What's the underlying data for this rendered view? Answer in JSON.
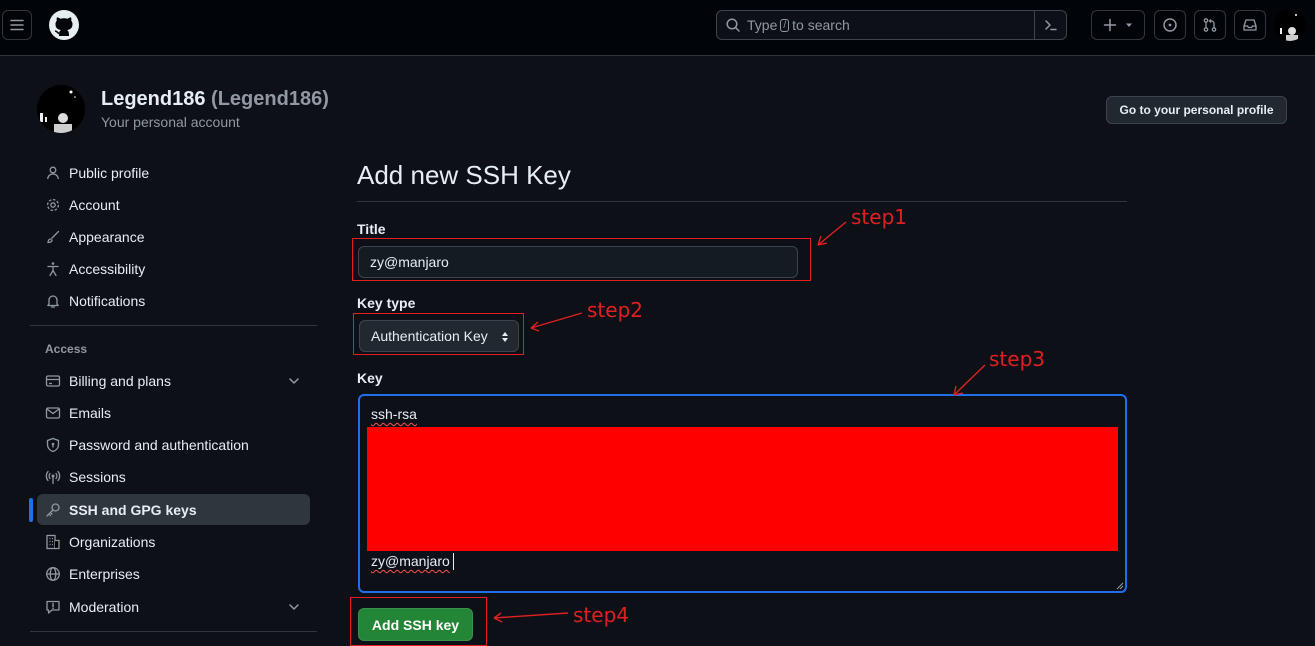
{
  "header": {
    "menu_icon": "hamburger-icon",
    "logo": "github-mark-logo",
    "search_prefix": "Type",
    "search_key": "/",
    "search_suffix": "to search",
    "icons": [
      "plus-icon",
      "issue-opened-icon",
      "git-pull-request-icon",
      "inbox-icon"
    ]
  },
  "user": {
    "name": "Legend186",
    "login": "(Legend186)",
    "subtitle": "Your personal account",
    "profile_button": "Go to your personal profile"
  },
  "sidebar": {
    "items_top": [
      {
        "label": "Public profile",
        "icon": "person-icon"
      },
      {
        "label": "Account",
        "icon": "gear-icon"
      },
      {
        "label": "Appearance",
        "icon": "paintbrush-icon"
      },
      {
        "label": "Accessibility",
        "icon": "accessibility-icon"
      },
      {
        "label": "Notifications",
        "icon": "bell-icon"
      }
    ],
    "access_heading": "Access",
    "items_access": [
      {
        "label": "Billing and plans",
        "icon": "credit-card-icon",
        "expandable": true
      },
      {
        "label": "Emails",
        "icon": "mail-icon"
      },
      {
        "label": "Password and authentication",
        "icon": "shield-lock-icon"
      },
      {
        "label": "Sessions",
        "icon": "broadcast-icon"
      },
      {
        "label": "SSH and GPG keys",
        "icon": "key-icon",
        "active": true
      },
      {
        "label": "Organizations",
        "icon": "organization-icon"
      },
      {
        "label": "Enterprises",
        "icon": "globe-icon"
      },
      {
        "label": "Moderation",
        "icon": "report-icon",
        "expandable": true
      }
    ]
  },
  "form": {
    "page_title": "Add new SSH Key",
    "title_label": "Title",
    "title_value": "zy@manjaro",
    "key_type_label": "Key type",
    "key_type_value": "Authentication Key",
    "key_label": "Key",
    "key_line1": "ssh-rsa",
    "key_line2": "zy@manjaro",
    "submit_label": "Add SSH key"
  },
  "annotations": {
    "step1": "step1",
    "step2": "step2",
    "step3": "step3",
    "step4": "step4"
  },
  "colors": {
    "background": "#0d1117",
    "header_background": "#010409",
    "accent_blue": "#1f6feb",
    "button_green": "#238636",
    "annotation_red": "#e02020",
    "redaction_red": "#ff0000"
  }
}
